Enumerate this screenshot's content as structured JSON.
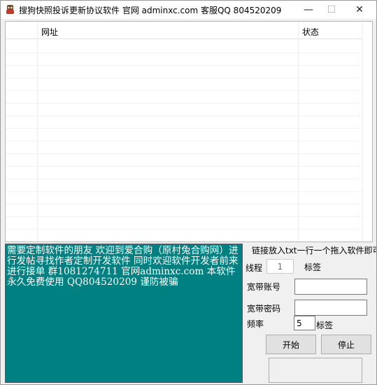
{
  "window": {
    "title": "搜狗快照投诉更新协议软件 官网 adminxc.com 客服QQ 804520209",
    "controls": {
      "minimize": "—",
      "maximize": "☐",
      "close": "✕"
    }
  },
  "list": {
    "columns": [
      "网址",
      "状态"
    ],
    "rows": []
  },
  "notice": {
    "text": "需要定制软件的朋友 欢迎到爱合购（原村兔合购网）进行发帖寻找作者定制开发软件 同时欢迎软件开发者前来进行接单 群1081274711 官网adminxc.com 本软件永久免费使用 QQ804520209 谨防被骗"
  },
  "form": {
    "hint": "链接放入txt一行一个拖入软件即可",
    "thread_label": "线程",
    "thread_value": "1",
    "thread_suffix": "标签",
    "account_label": "宽带账号",
    "account_value": "",
    "password_label": "宽带密码",
    "password_value": "",
    "freq_label": "频率",
    "freq_value": "5",
    "freq_suffix": "标签",
    "start_button": "开始",
    "stop_button": "停止"
  }
}
